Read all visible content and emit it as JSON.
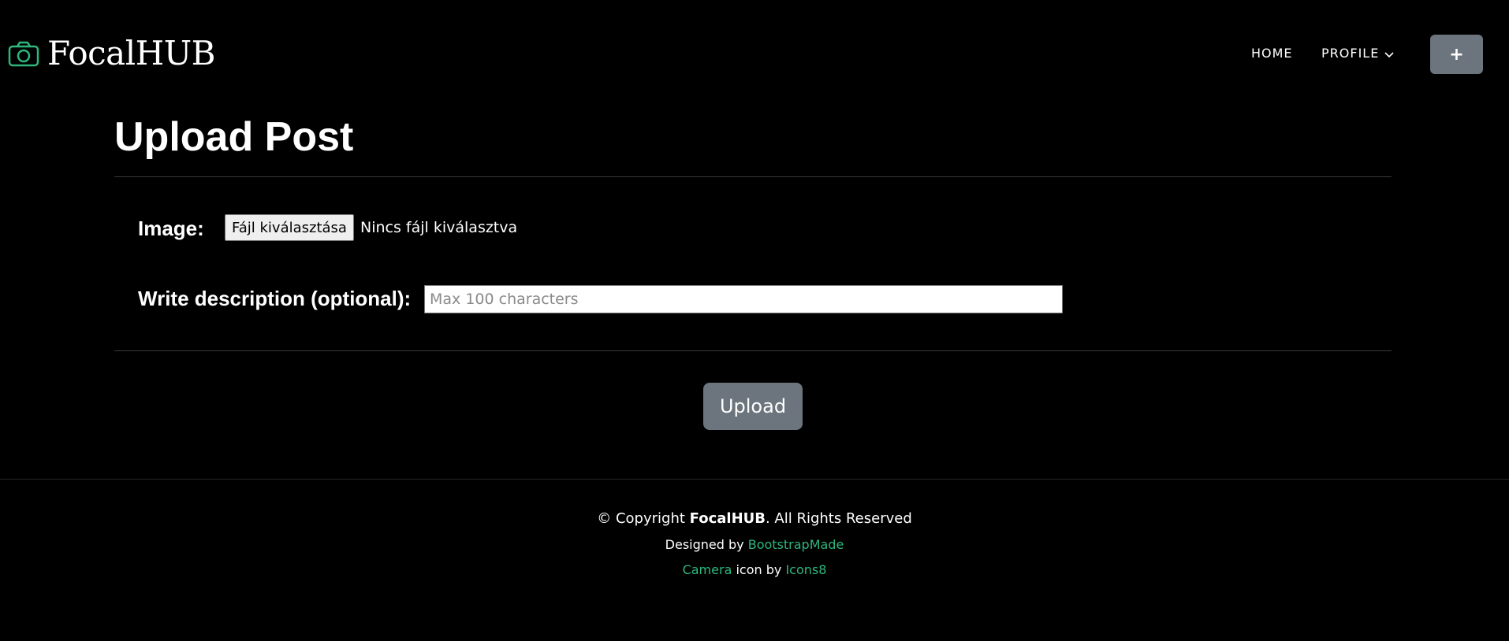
{
  "brand": {
    "name": "FocalHUB",
    "icon": "camera-icon",
    "accent_color": "#2eb67d"
  },
  "nav": {
    "home_label": "HOME",
    "profile_label": "PROFILE",
    "add_label": "+"
  },
  "main": {
    "title": "Upload Post",
    "image_label": "Image:",
    "file_button_label": "Fájl kiválasztása",
    "file_status": "Nincs fájl kiválasztva",
    "description_label": "Write description (optional):",
    "description_placeholder": "Max 100 characters",
    "description_value": "",
    "upload_label": "Upload"
  },
  "footer": {
    "copyright_prefix": "© Copyright ",
    "copyright_brand": "FocalHUB",
    "copyright_suffix": ". All Rights Reserved",
    "designed_prefix": "Designed by ",
    "designed_link": "BootstrapMade",
    "icon_link": "Camera",
    "icon_middle": " icon by ",
    "icon_source_link": "Icons8"
  },
  "colors": {
    "background": "#000000",
    "button_gray": "#6c757d",
    "link_green": "#2eb67d"
  }
}
